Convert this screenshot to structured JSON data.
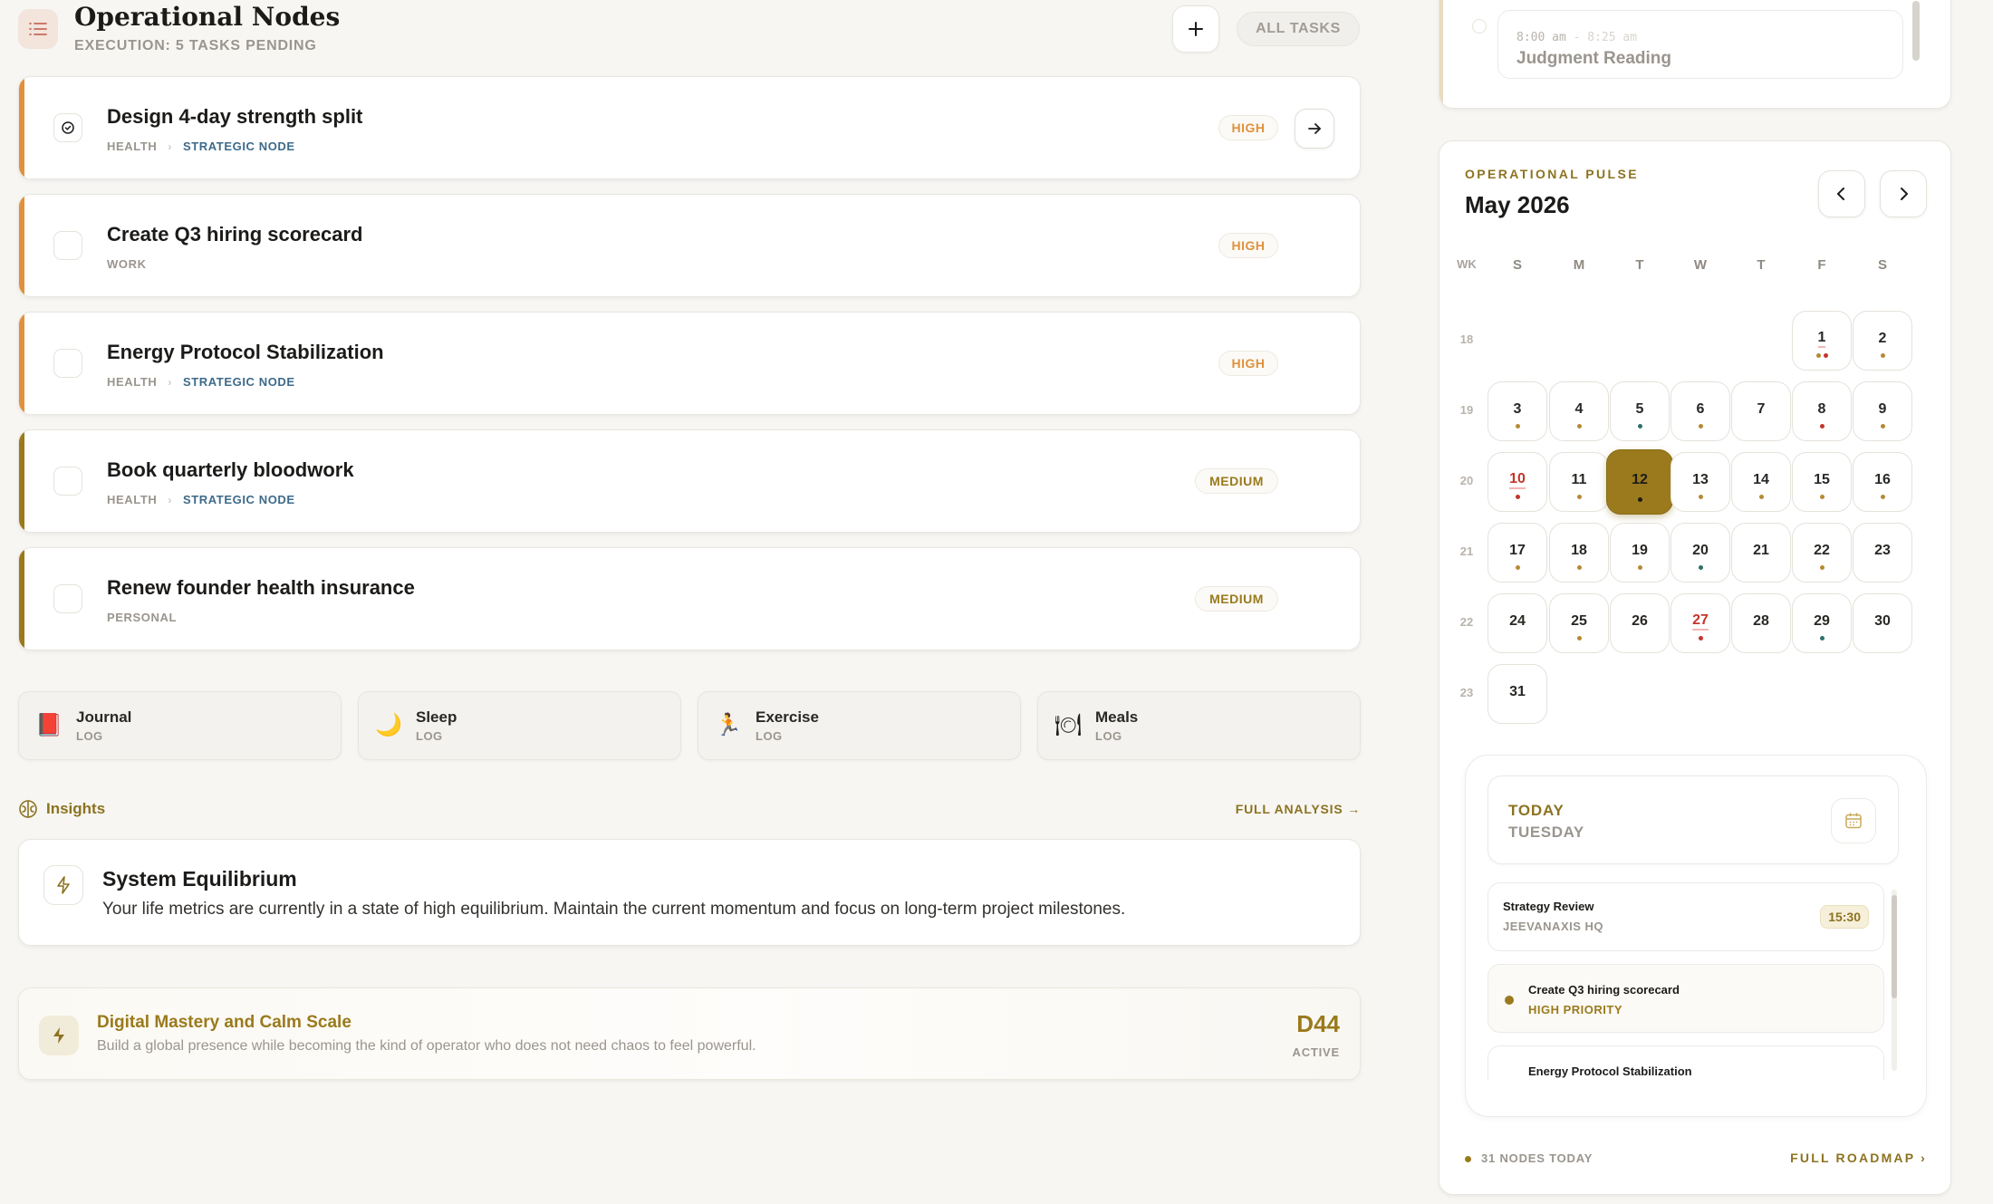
{
  "header": {
    "title": "Operational Nodes",
    "subtitle": "EXECUTION: 5 TASKS PENDING",
    "all_tasks_label": "ALL TASKS"
  },
  "tasks": [
    {
      "title": "Design 4-day strength split",
      "category": "HEALTH",
      "node": "STRATEGIC NODE",
      "priority": "HIGH",
      "status": "in-progress"
    },
    {
      "title": "Create Q3 hiring scorecard",
      "category": "WORK",
      "node": "",
      "priority": "HIGH",
      "status": "open"
    },
    {
      "title": "Energy Protocol Stabilization",
      "category": "HEALTH",
      "node": "STRATEGIC NODE",
      "priority": "HIGH",
      "status": "open"
    },
    {
      "title": "Book quarterly bloodwork",
      "category": "HEALTH",
      "node": "STRATEGIC NODE",
      "priority": "MEDIUM",
      "status": "open"
    },
    {
      "title": "Renew founder health insurance",
      "category": "PERSONAL",
      "node": "",
      "priority": "MEDIUM",
      "status": "open"
    }
  ],
  "logs": [
    {
      "name": "Journal",
      "sub": "LOG",
      "icon": "journal-icon",
      "glyph": "📕"
    },
    {
      "name": "Sleep",
      "sub": "LOG",
      "icon": "moon-icon",
      "glyph": "🌙"
    },
    {
      "name": "Exercise",
      "sub": "LOG",
      "icon": "runner-icon",
      "glyph": "🏃"
    },
    {
      "name": "Meals",
      "sub": "LOG",
      "icon": "plate-icon",
      "glyph": "🍽"
    }
  ],
  "insights": {
    "label": "Insights",
    "full_analysis": "FULL ANALYSIS →",
    "card_title": "System Equilibrium",
    "card_body": "Your life metrics are currently in a state of high equilibrium. Maintain the current momentum and focus on long-term project milestones."
  },
  "mission": {
    "title": "Digital Mastery and Calm Scale",
    "body": "Build a global presence while becoming the kind of operator who does not need chaos to feel powerful.",
    "code": "D44",
    "status": "ACTIVE"
  },
  "top_event": {
    "time": "8:00 am",
    "time_end": "- 8:25 am",
    "title": "Judgment Reading"
  },
  "calendar": {
    "label": "OPERATIONAL PULSE",
    "month": "May 2026",
    "weekday_headers": [
      "WK",
      "S",
      "M",
      "T",
      "W",
      "T",
      "F",
      "S"
    ],
    "selected_day": 12,
    "weeks": [
      {
        "wk": "18",
        "days": [
          null,
          null,
          null,
          null,
          null,
          {
            "d": 1,
            "dots": [
              "amber",
              "red"
            ],
            "underline": true
          },
          {
            "d": 2,
            "dots": [
              "amber"
            ]
          }
        ]
      },
      {
        "wk": "19",
        "days": [
          {
            "d": 3,
            "dots": [
              "amber"
            ]
          },
          {
            "d": 4,
            "dots": [
              "amber"
            ]
          },
          {
            "d": 5,
            "dots": [
              "teal"
            ]
          },
          {
            "d": 6,
            "dots": [
              "amber"
            ]
          },
          {
            "d": 7,
            "dots": []
          },
          {
            "d": 8,
            "dots": [
              "red"
            ]
          },
          {
            "d": 9,
            "dots": [
              "amber"
            ]
          }
        ]
      },
      {
        "wk": "20",
        "days": [
          {
            "d": 10,
            "dots": [
              "red"
            ],
            "red": true,
            "underline": true
          },
          {
            "d": 11,
            "dots": [
              "amber"
            ]
          },
          {
            "d": 12,
            "dots": [
              "dark"
            ],
            "today": true
          },
          {
            "d": 13,
            "dots": [
              "amber"
            ]
          },
          {
            "d": 14,
            "dots": [
              "amber"
            ]
          },
          {
            "d": 15,
            "dots": [
              "amber"
            ]
          },
          {
            "d": 16,
            "dots": [
              "amber"
            ]
          }
        ]
      },
      {
        "wk": "21",
        "days": [
          {
            "d": 17,
            "dots": [
              "amber"
            ]
          },
          {
            "d": 18,
            "dots": [
              "amber"
            ]
          },
          {
            "d": 19,
            "dots": [
              "amber"
            ]
          },
          {
            "d": 20,
            "dots": [
              "teal"
            ]
          },
          {
            "d": 21,
            "dots": []
          },
          {
            "d": 22,
            "dots": [
              "amber"
            ]
          },
          {
            "d": 23,
            "dots": []
          }
        ]
      },
      {
        "wk": "22",
        "days": [
          {
            "d": 24,
            "dots": []
          },
          {
            "d": 25,
            "dots": [
              "amber"
            ]
          },
          {
            "d": 26,
            "dots": []
          },
          {
            "d": 27,
            "dots": [
              "red"
            ],
            "red": true,
            "underline": true
          },
          {
            "d": 28,
            "dots": []
          },
          {
            "d": 29,
            "dots": [
              "teal"
            ]
          },
          {
            "d": 30,
            "dots": []
          }
        ]
      },
      {
        "wk": "23",
        "days": [
          {
            "d": 31,
            "dots": []
          },
          null,
          null,
          null,
          null,
          null,
          null
        ]
      }
    ]
  },
  "today": {
    "label": "TODAY",
    "weekday": "TUESDAY",
    "agenda": [
      {
        "title": "Strategy Review",
        "sub": "JEEVANAXIS HQ",
        "time": "15:30"
      },
      {
        "title": "Create Q3 hiring scorecard",
        "sub": "HIGH PRIORITY"
      },
      {
        "title": "Energy Protocol Stabilization"
      }
    ]
  },
  "footer": {
    "nodes_today": "31 NODES TODAY",
    "full_roadmap": "FULL ROADMAP"
  },
  "colors": {
    "accent_gold": "#9a7a1c",
    "priority_high": "#e0913d",
    "node_blue": "#3d6a8a",
    "accent_red": "#c5342c"
  }
}
